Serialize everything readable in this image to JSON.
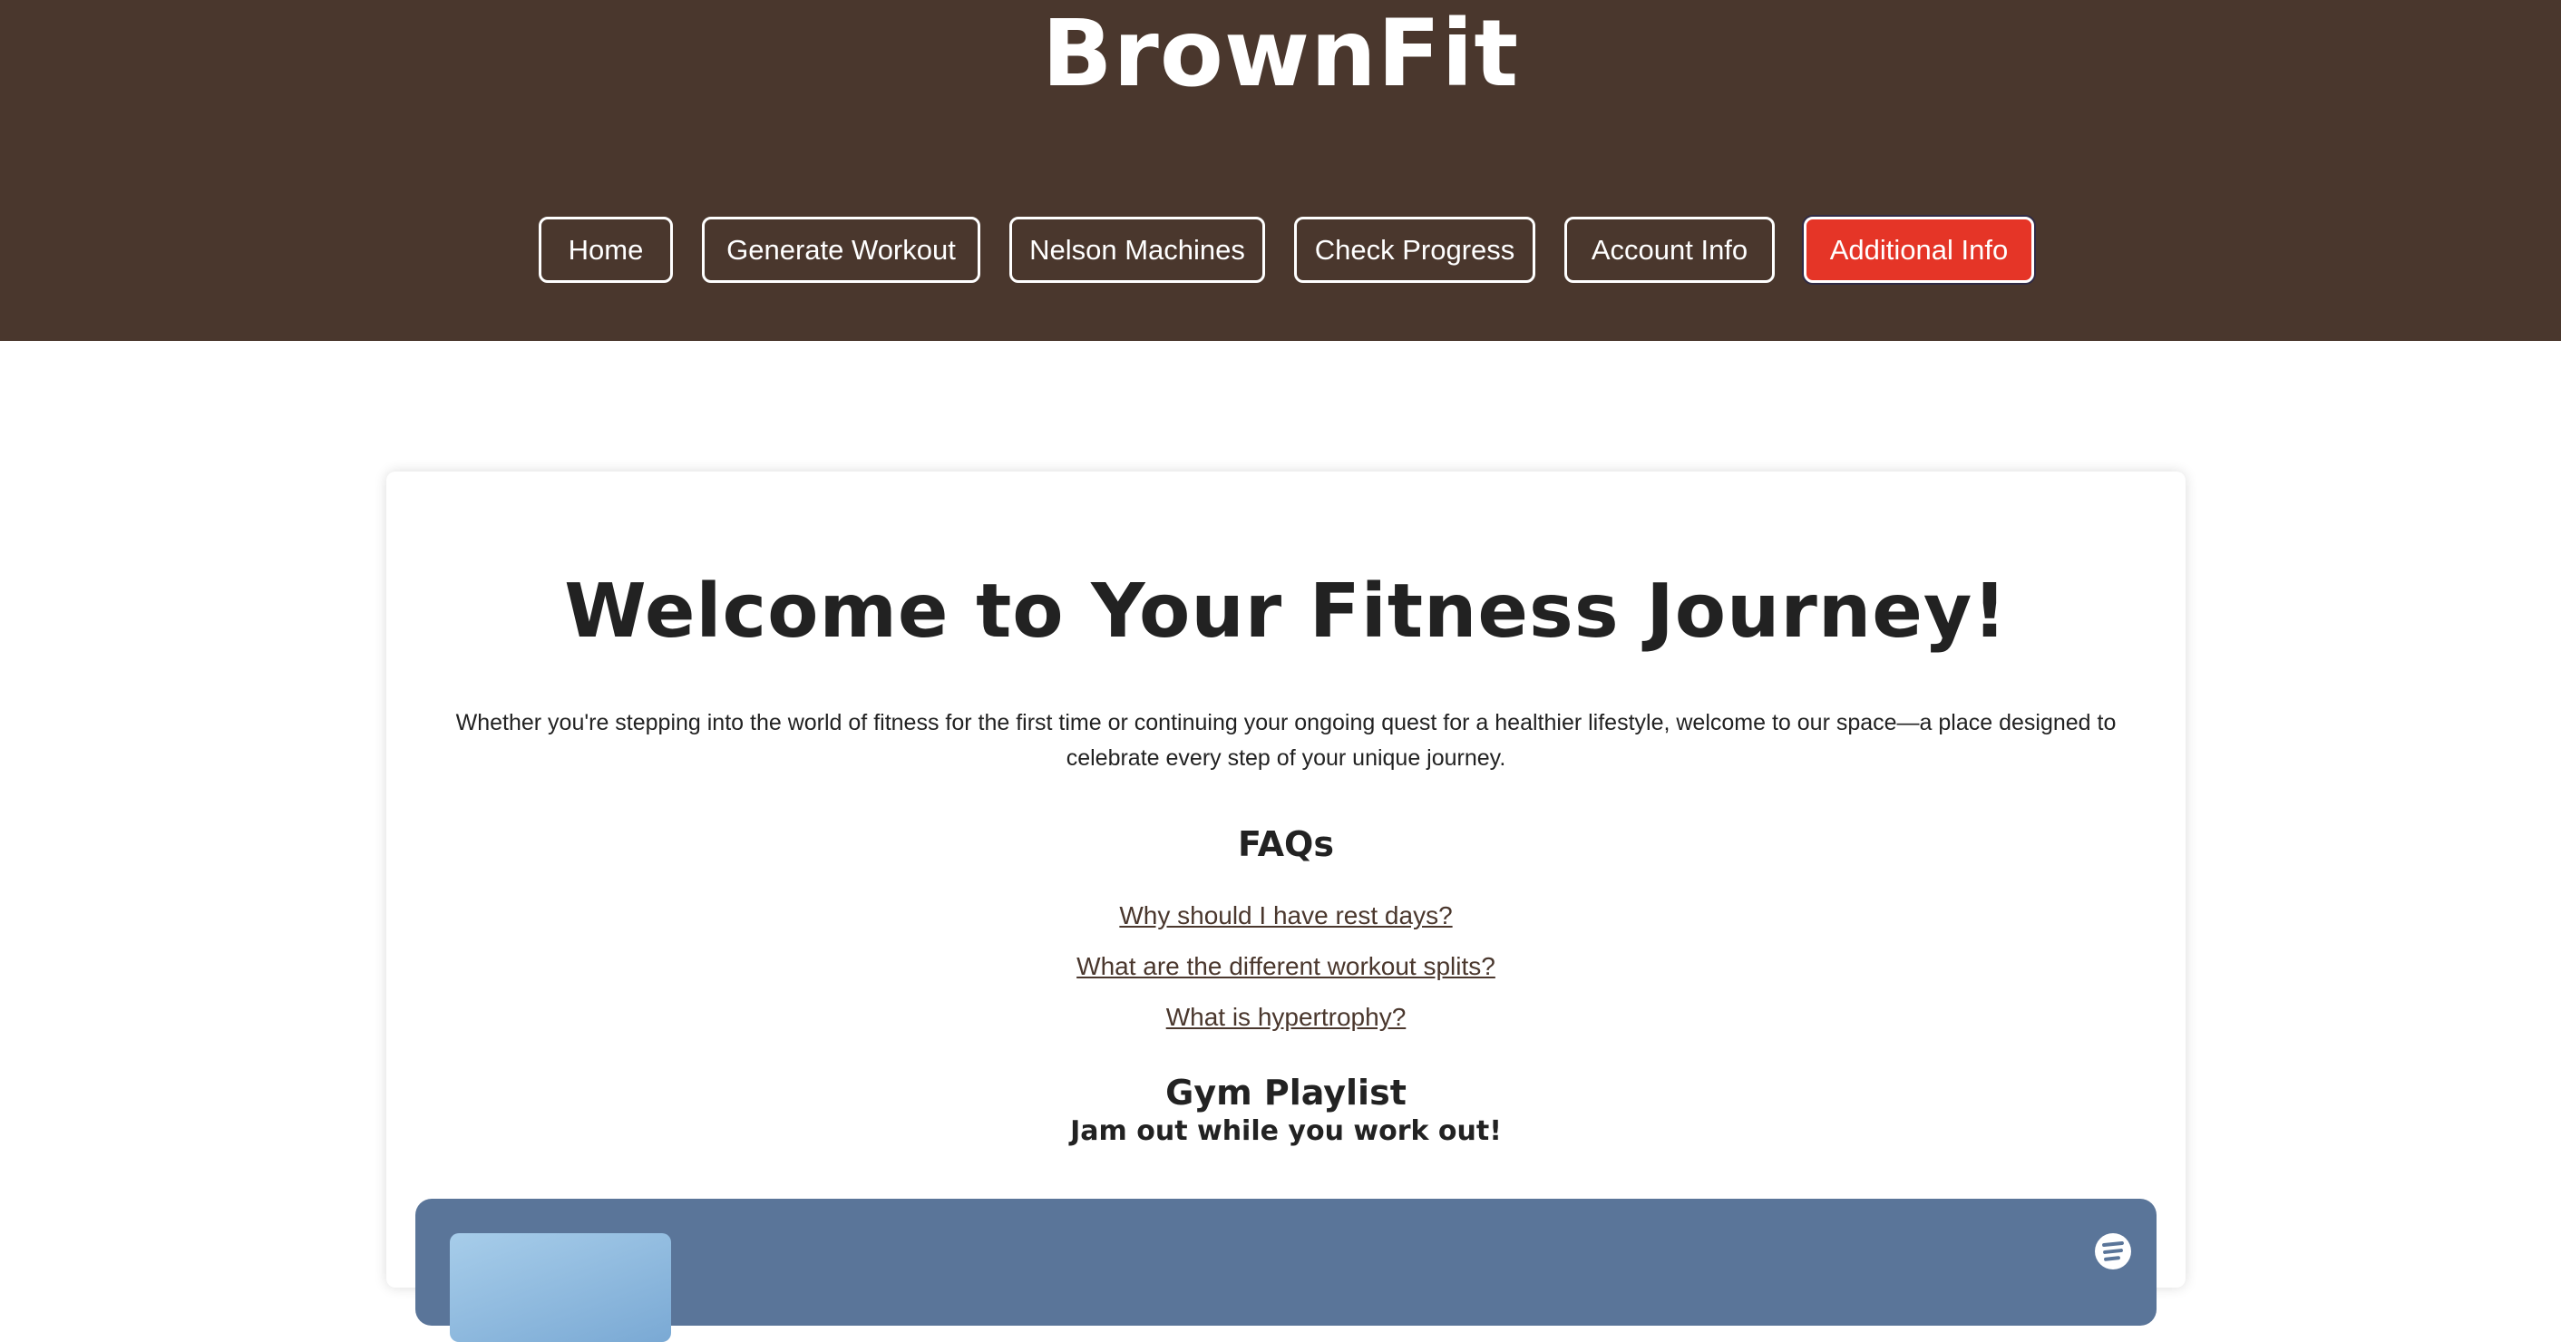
{
  "header": {
    "brand": "BrownFit",
    "nav": [
      {
        "label": "Home",
        "active": false
      },
      {
        "label": "Generate Workout",
        "active": false
      },
      {
        "label": "Nelson Machines",
        "active": false
      },
      {
        "label": "Check Progress",
        "active": false
      },
      {
        "label": "Account Info",
        "active": false
      },
      {
        "label": "Additional Info",
        "active": true
      }
    ]
  },
  "main": {
    "title": "Welcome to Your Fitness Journey!",
    "intro": "Whether you're stepping into the world of fitness for the first time or continuing your ongoing quest for a healthier lifestyle, welcome to our space—a place designed to celebrate every step of your unique journey.",
    "faq": {
      "title": "FAQs",
      "links": [
        "Why should I have rest days?",
        "What are the different workout splits?",
        "What is hypertrophy?"
      ]
    },
    "playlist": {
      "title": "Gym Playlist",
      "subtitle": "Jam out while you work out!",
      "player_icon": "spotify-icon"
    }
  },
  "colors": {
    "header_bg": "#4a372d",
    "active_button": "#e53527",
    "link": "#4a372d",
    "player_bg": "#5a7599"
  }
}
